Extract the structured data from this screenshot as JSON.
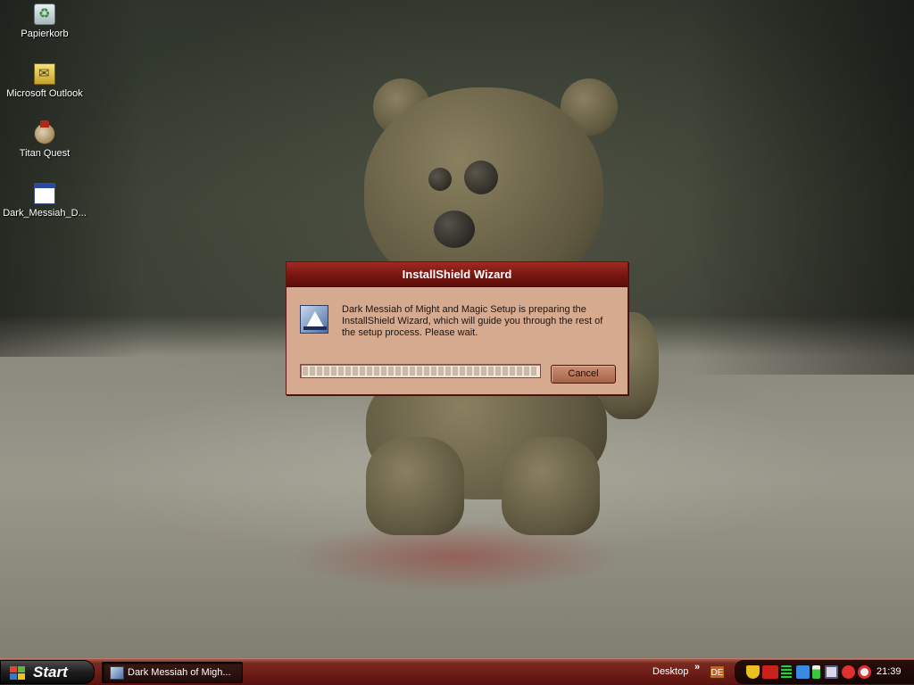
{
  "desktop": {
    "icons": [
      {
        "label": "Papierkorb",
        "icon": "recycle-bin-icon"
      },
      {
        "label": "Microsoft Outlook",
        "icon": "outlook-icon"
      },
      {
        "label": "Titan Quest",
        "icon": "titan-quest-icon"
      },
      {
        "label": "Dark_Messiah_D...",
        "icon": "setup-window-icon"
      }
    ]
  },
  "dialog": {
    "title": "InstallShield Wizard",
    "icon": "installshield-icon",
    "message": "Dark Messiah of Might and Magic Setup is preparing the InstallShield Wizard, which will guide you through the rest of the setup process. Please wait.",
    "progress": 1.0,
    "cancel_label": "Cancel"
  },
  "taskbar": {
    "start_label": "Start",
    "task_label": "Dark Messiah of Migh...",
    "desktop_label": "Desktop",
    "toolbar_chevron": "»",
    "language": "DE",
    "tray_icons": [
      "shield-icon",
      "ati-icon",
      "meter-icon",
      "network-icon",
      "battery-icon",
      "monitor-icon",
      "antivirus-icon",
      "update-icon"
    ],
    "clock": "21:39"
  },
  "colors": {
    "taskbar": "#6a1c16",
    "dialog_bg": "#d5aa8f",
    "dialog_title": "#7a1812"
  }
}
